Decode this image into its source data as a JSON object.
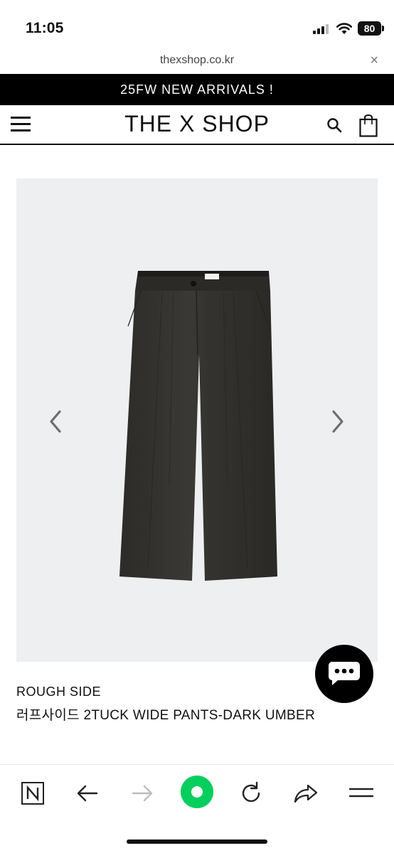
{
  "status_bar": {
    "time": "11:05",
    "battery": "80"
  },
  "browser": {
    "url": "thexshop.co.kr",
    "close_icon": "×"
  },
  "announcement": "25FW NEW ARRIVALS !",
  "header": {
    "logo": "THE X SHOP",
    "icons": [
      "menu-icon",
      "search-icon",
      "shopping-bag-icon"
    ]
  },
  "product": {
    "brand": "ROUGH SIDE",
    "name": "러프사이드 2TUCK WIDE PANTS-DARK UMBER",
    "image_background": "#eeeff1",
    "garment_color": "#33322e"
  },
  "chat": {
    "icon": "chat-bubble-icon"
  },
  "toolbar": {
    "items": [
      "naver-icon",
      "back-icon",
      "forward-icon",
      "green-dot-icon",
      "refresh-icon",
      "share-icon",
      "menu-icon"
    ],
    "accent": "#03cf5d"
  }
}
